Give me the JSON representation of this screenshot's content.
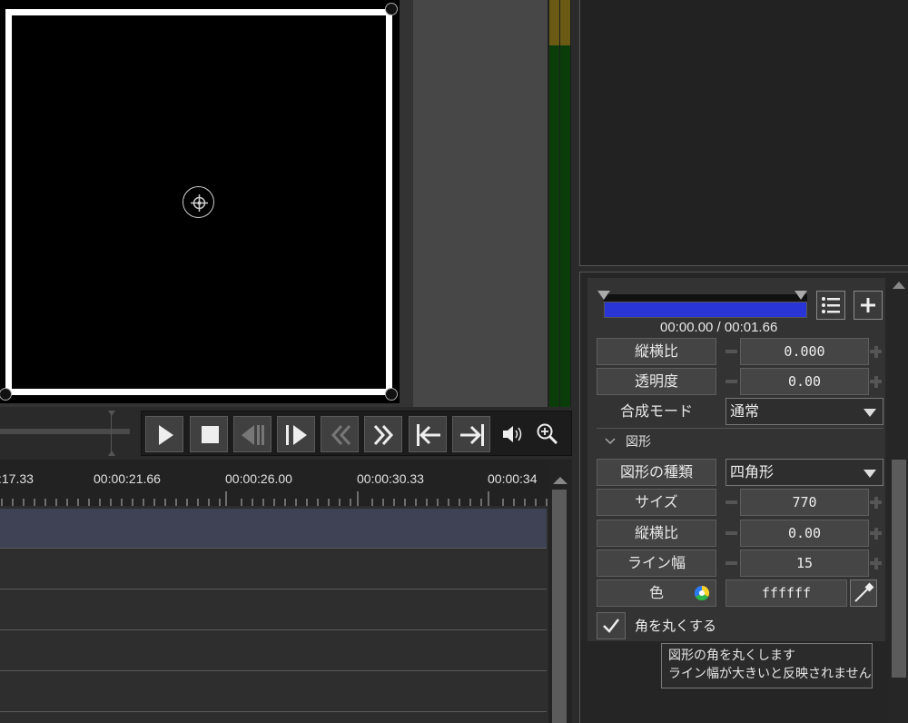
{
  "transport": {
    "buttons": [
      "play",
      "stop",
      "prev-frame",
      "next-frame",
      "rewind",
      "fast-forward",
      "jump-start",
      "jump-end"
    ],
    "icons": [
      "volume-icon",
      "zoom-icon"
    ]
  },
  "timeline": {
    "ruler_labels": [
      ":17.33",
      "00:00:21.66",
      "00:00:26.00",
      "00:00:30.33",
      "00:00:34"
    ]
  },
  "props": {
    "range_time": "00:00.00 / 00:01.66",
    "aspect_ratio_label": "縦横比",
    "aspect_ratio_value": "0.000",
    "opacity_label": "透明度",
    "opacity_value": "0.00",
    "blend_mode_label": "合成モード",
    "blend_mode_value": "通常",
    "section_title": "図形",
    "shape_type_label": "図形の種類",
    "shape_type_value": "四角形",
    "size_label": "サイズ",
    "size_value": "770",
    "aspect2_label": "縦横比",
    "aspect2_value": "0.00",
    "line_width_label": "ライン幅",
    "line_width_value": "15",
    "color_label": "色",
    "color_value": "ffffff",
    "round_corners_label": "角を丸くする",
    "round_corners_checked": true
  },
  "tooltip": {
    "line1": "図形の角を丸くします",
    "line2": "ライン幅が大きいと反映されません"
  },
  "colors": {
    "range_fill": "#2a35d8",
    "track_highlight": "#3f4254",
    "meter_green": "#0b3d0b",
    "meter_peak": "#6b5a14"
  }
}
